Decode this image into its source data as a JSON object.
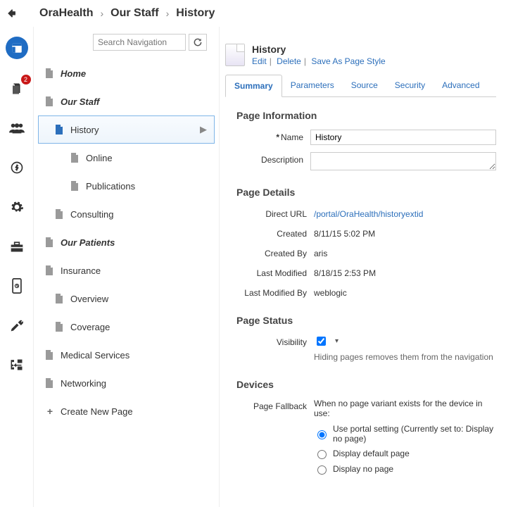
{
  "breadcrumb": {
    "items": [
      "OraHealth",
      "Our Staff",
      "History"
    ],
    "sep": "›"
  },
  "rail": {
    "badge": "2"
  },
  "nav": {
    "search_placeholder": "Search Navigation",
    "items": [
      {
        "label": "Home",
        "level": 0
      },
      {
        "label": "Our Staff",
        "level": 0
      },
      {
        "label": "History",
        "level": 1,
        "selected": true
      },
      {
        "label": "Online",
        "level": 2
      },
      {
        "label": "Publications",
        "level": 2
      },
      {
        "label": "Consulting",
        "level": 1
      },
      {
        "label": "Our Patients",
        "level": 0
      },
      {
        "label": "Insurance",
        "level": 0
      },
      {
        "label": "Overview",
        "level": 1
      },
      {
        "label": "Coverage",
        "level": 1
      },
      {
        "label": "Medical Services",
        "level": 0
      },
      {
        "label": "Networking",
        "level": 0
      }
    ],
    "create_label": "Create New Page"
  },
  "page": {
    "title": "History",
    "actions": {
      "edit": "Edit",
      "delete": "Delete",
      "save_as": "Save As Page Style"
    }
  },
  "tabs": [
    "Summary",
    "Parameters",
    "Source",
    "Security",
    "Advanced"
  ],
  "summary": {
    "section_info": "Page Information",
    "name_label": "Name",
    "name_value": "History",
    "desc_label": "Description",
    "section_details": "Page Details",
    "url_label": "Direct URL",
    "url_value": "/portal/OraHealth/historyextid",
    "created_label": "Created",
    "created_value": "8/11/15 5:02 PM",
    "createdby_label": "Created By",
    "createdby_value": "aris",
    "modified_label": "Last Modified",
    "modified_value": "8/18/15 2:53 PM",
    "modifiedby_label": "Last Modified By",
    "modifiedby_value": "weblogic",
    "section_status": "Page Status",
    "visibility_label": "Visibility",
    "visibility_hint": "Hiding pages removes them from the navigation",
    "section_devices": "Devices",
    "fallback_label": "Page Fallback",
    "fallback_intro": "When no page variant exists for the device in use:",
    "fallback_opt1": "Use portal setting (Currently set to: Display no page)",
    "fallback_opt2": "Display default page",
    "fallback_opt3": "Display no page"
  }
}
